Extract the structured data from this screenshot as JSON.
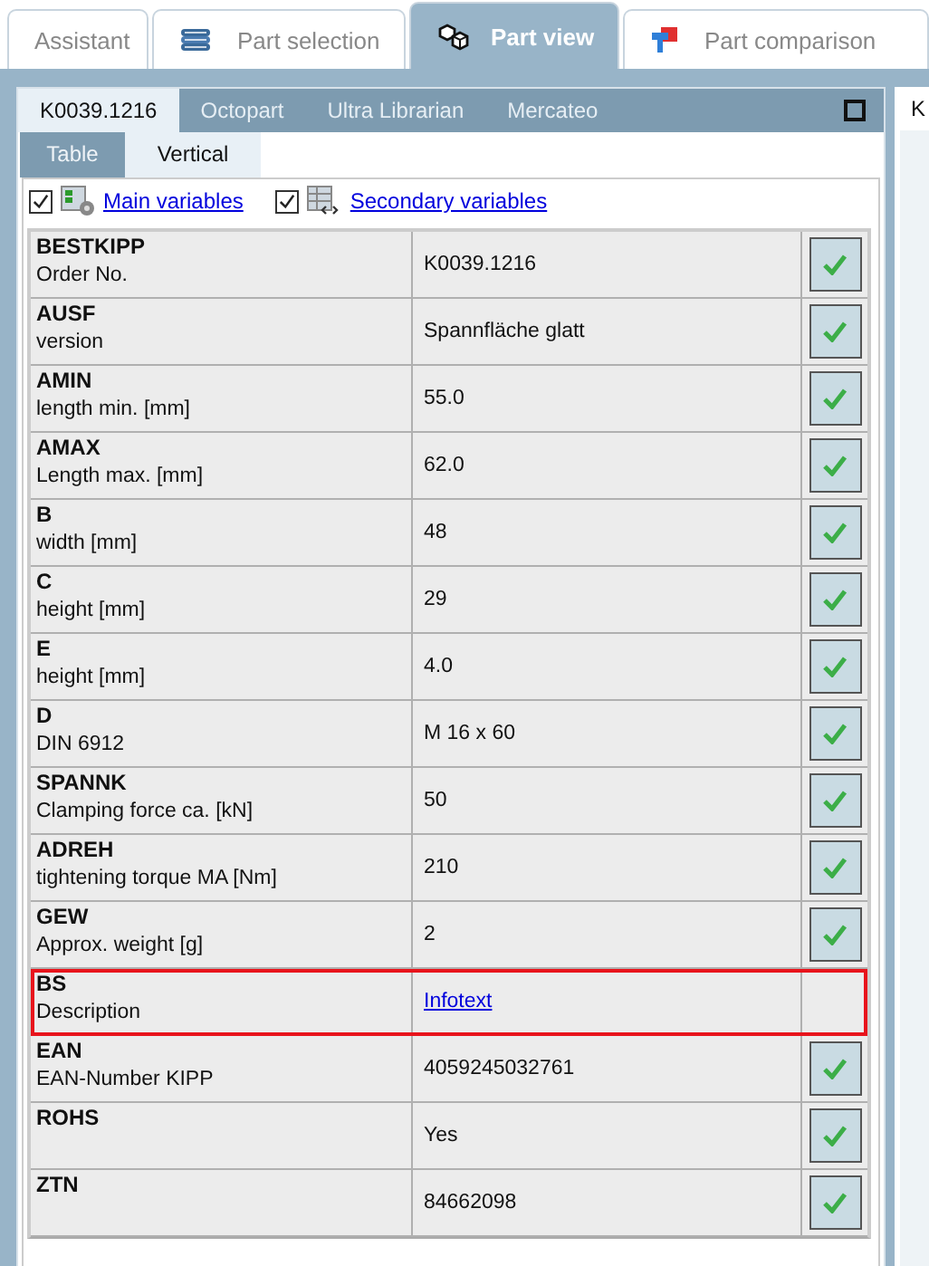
{
  "main_tabs": [
    {
      "label": "Assistant",
      "selected": false
    },
    {
      "label": "Part selection",
      "selected": false
    },
    {
      "label": "Part view",
      "selected": true
    },
    {
      "label": "Part comparison",
      "selected": false
    }
  ],
  "panel": {
    "tabs": [
      {
        "label": "K0039.1216",
        "selected": true
      },
      {
        "label": "Octopart",
        "selected": false
      },
      {
        "label": "Ultra Librarian",
        "selected": false
      },
      {
        "label": "Mercateo",
        "selected": false
      }
    ],
    "view_tabs": [
      {
        "label": "Table",
        "selected": false
      },
      {
        "label": "Vertical",
        "selected": true
      }
    ],
    "filters": [
      {
        "label": "Main variables",
        "checked": true
      },
      {
        "label": "Secondary variables",
        "checked": true
      }
    ],
    "rows": [
      {
        "name": "BESTKIPP",
        "description": "Order No.",
        "value": "K0039.1216",
        "kind": "text",
        "confirmed": true,
        "highlighted": false
      },
      {
        "name": "AUSF",
        "description": "version",
        "value": "Spannfläche glatt",
        "kind": "text",
        "confirmed": true,
        "highlighted": false
      },
      {
        "name": "AMIN",
        "description": "length min. [mm]",
        "value": "55.0",
        "kind": "text",
        "confirmed": true,
        "highlighted": false
      },
      {
        "name": "AMAX",
        "description": "Length max. [mm]",
        "value": "62.0",
        "kind": "text",
        "confirmed": true,
        "highlighted": false
      },
      {
        "name": "B",
        "description": "width [mm]",
        "value": "48",
        "kind": "text",
        "confirmed": true,
        "highlighted": false
      },
      {
        "name": "C",
        "description": "height [mm]",
        "value": "29",
        "kind": "text",
        "confirmed": true,
        "highlighted": false
      },
      {
        "name": "E",
        "description": "height [mm]",
        "value": "4.0",
        "kind": "text",
        "confirmed": true,
        "highlighted": false
      },
      {
        "name": "D",
        "description": "DIN 6912",
        "value": "M 16 x 60",
        "kind": "text",
        "confirmed": true,
        "highlighted": false
      },
      {
        "name": "SPANNK",
        "description": "Clamping force ca. [kN]",
        "value": "50",
        "kind": "text",
        "confirmed": true,
        "highlighted": false
      },
      {
        "name": "ADREH",
        "description": "tightening torque MA [Nm]",
        "value": "210",
        "kind": "text",
        "confirmed": true,
        "highlighted": false
      },
      {
        "name": "GEW",
        "description": "Approx. weight [g]",
        "value": "2",
        "kind": "text",
        "confirmed": true,
        "highlighted": false
      },
      {
        "name": "BS",
        "description": "Description",
        "value": "Infotext",
        "kind": "link",
        "confirmed": false,
        "highlighted": true
      },
      {
        "name": "EAN",
        "description": "EAN-Number KIPP",
        "value": "4059245032761",
        "kind": "text",
        "confirmed": true,
        "highlighted": false
      },
      {
        "name": "ROHS",
        "value": "Yes",
        "kind": "text",
        "confirmed": true,
        "highlighted": false
      },
      {
        "name": "ZTN",
        "value": "84662098",
        "kind": "text",
        "confirmed": true,
        "highlighted": false
      }
    ]
  },
  "side_panel": {
    "tab_label": "K"
  }
}
